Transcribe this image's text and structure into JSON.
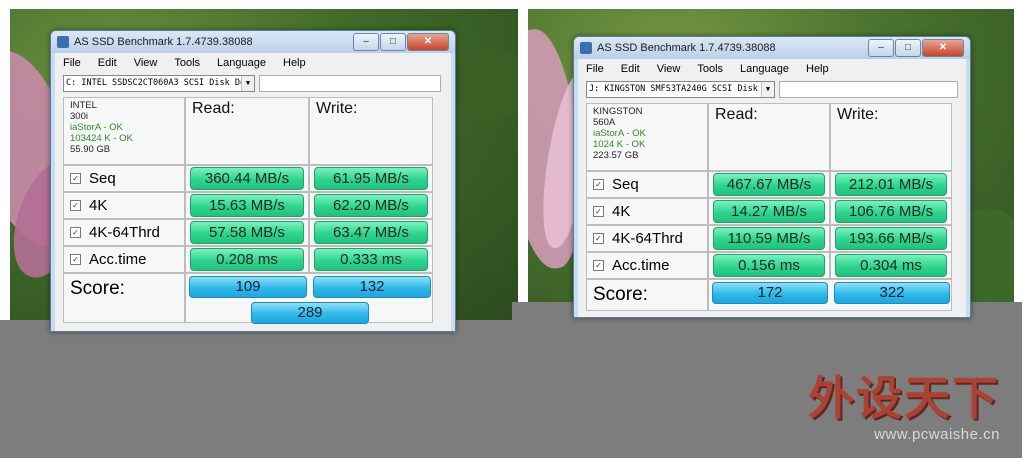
{
  "windows": [
    {
      "title": "AS SSD Benchmark 1.7.4739.38088",
      "menu": [
        "File",
        "Edit",
        "View",
        "Tools",
        "Language",
        "Help"
      ],
      "device_select": "C: INTEL SSDSC2CT060A3 SCSI Disk Dev",
      "info": {
        "model": "INTEL",
        "firmware": "300i",
        "driver": "iaStorA - OK",
        "alignment": "103424 K - OK",
        "size": "55.90 GB"
      },
      "headers": {
        "read": "Read:",
        "write": "Write:"
      },
      "rows": [
        {
          "label": "Seq",
          "read": "360.44 MB/s",
          "write": "61.95 MB/s"
        },
        {
          "label": "4K",
          "read": "15.63 MB/s",
          "write": "62.20 MB/s"
        },
        {
          "label": "4K-64Thrd",
          "read": "57.58 MB/s",
          "write": "63.47 MB/s"
        },
        {
          "label": "Acc.time",
          "read": "0.208 ms",
          "write": "0.333 ms"
        }
      ],
      "score": {
        "label": "Score:",
        "read": "109",
        "write": "132",
        "total": "289"
      }
    },
    {
      "title": "AS SSD Benchmark 1.7.4739.38088",
      "menu": [
        "File",
        "Edit",
        "View",
        "Tools",
        "Language",
        "Help"
      ],
      "device_select": "J: KINGSTON SMFS3TA240G SCSI Disk De",
      "info": {
        "model": "KINGSTON",
        "firmware": "560A",
        "driver": "iaStorA - OK",
        "alignment": "1024 K - OK",
        "size": "223.57 GB"
      },
      "headers": {
        "read": "Read:",
        "write": "Write:"
      },
      "rows": [
        {
          "label": "Seq",
          "read": "467.67 MB/s",
          "write": "212.01 MB/s"
        },
        {
          "label": "4K",
          "read": "14.27 MB/s",
          "write": "106.76 MB/s"
        },
        {
          "label": "4K-64Thrd",
          "read": "110.59 MB/s",
          "write": "193.66 MB/s"
        },
        {
          "label": "Acc.time",
          "read": "0.156 ms",
          "write": "0.304 ms"
        }
      ],
      "score": {
        "label": "Score:",
        "read": "172",
        "write": "322"
      }
    }
  ],
  "watermark": {
    "brand": "外设天下",
    "url": "www.pcwaishe.cn"
  },
  "colors": {
    "result_green": "#2ed48e",
    "score_blue": "#2fb8ea",
    "window_frame": "#c8dcef"
  }
}
